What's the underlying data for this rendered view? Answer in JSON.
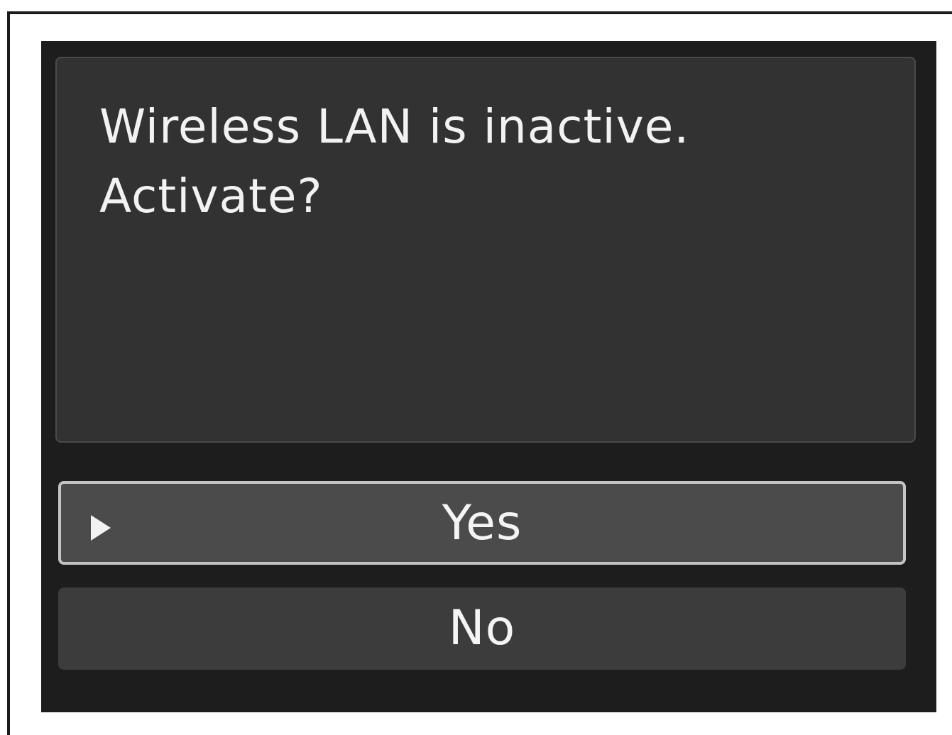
{
  "dialog": {
    "message_line_1": "Wireless LAN is inactive.",
    "message_line_2": "Activate?"
  },
  "options": {
    "yes_label": "Yes",
    "no_label": "No",
    "selected": "Yes"
  },
  "icons": {
    "selection_cursor": "triangle-right-icon"
  },
  "colors": {
    "screen_background": "#1d1d1d",
    "panel_background": "#323232",
    "selected_option": "#4b4b4b",
    "selected_border": "#c4c4c4",
    "unselected_option": "#3c3c3c",
    "text": "#f2f2f2"
  }
}
